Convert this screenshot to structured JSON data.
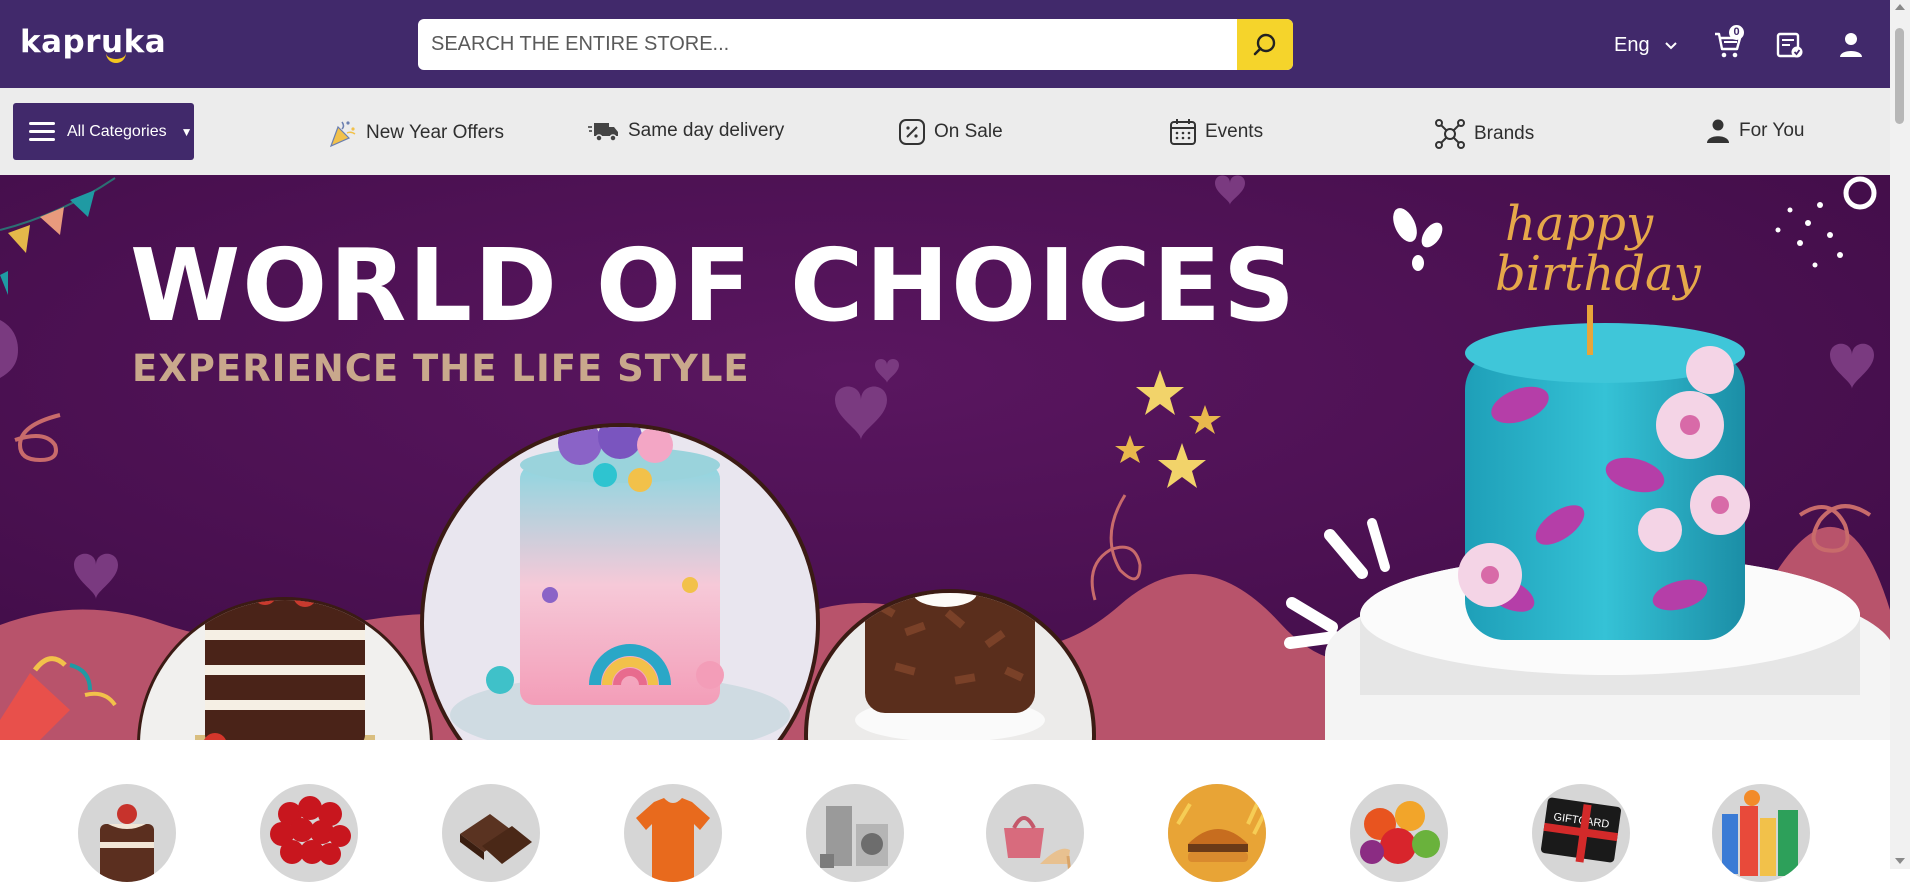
{
  "header": {
    "logo_text": "kapruka",
    "search": {
      "placeholder": "SEARCH THE ENTIRE STORE..."
    },
    "language": "Eng",
    "cart_count": "0",
    "brand_color": "#41296b",
    "accent_color": "#f5d42b"
  },
  "nav": {
    "all_categories": "All Categories",
    "links": [
      {
        "label": "New Year Offers",
        "icon": "party-popper-icon"
      },
      {
        "label": "Same day delivery",
        "icon": "delivery-truck-icon"
      },
      {
        "label": "On Sale",
        "icon": "percent-tag-icon"
      },
      {
        "label": "Events",
        "icon": "calendar-icon"
      },
      {
        "label": "Brands",
        "icon": "network-icon"
      },
      {
        "label": "For You",
        "icon": "user-icon"
      }
    ]
  },
  "hero": {
    "title": "WORLD OF CHOICES",
    "subtitle": "EXPERIENCE THE LIFE STYLE",
    "topper_text": "happy birthday"
  },
  "categories": [
    {
      "name": "Cakes"
    },
    {
      "name": "Flowers"
    },
    {
      "name": "Chocolates"
    },
    {
      "name": "Clothing"
    },
    {
      "name": "Electronics"
    },
    {
      "name": "Fashion"
    },
    {
      "name": "Food"
    },
    {
      "name": "Fruits"
    },
    {
      "name": "Gift Cards"
    },
    {
      "name": "Groceries"
    }
  ],
  "gift_card_label": "GIFTCARD"
}
